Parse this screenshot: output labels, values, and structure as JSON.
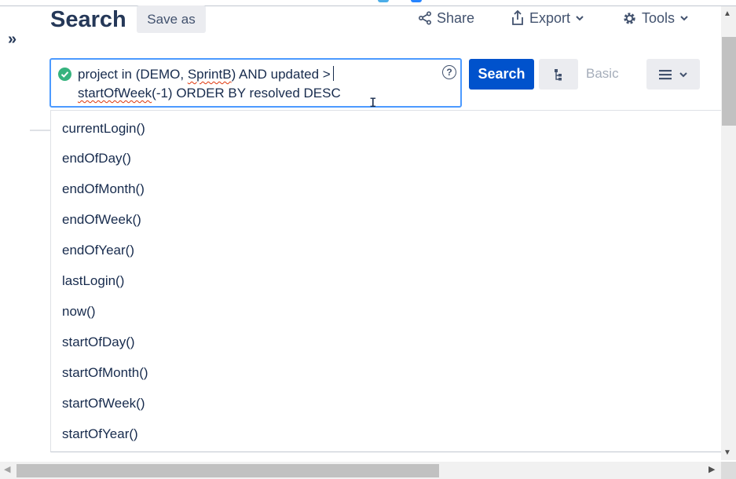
{
  "header": {
    "title": "Search",
    "save_as_label": "Save as",
    "share_label": "Share",
    "export_label": "Export",
    "tools_label": "Tools"
  },
  "query": {
    "line1_prefix": "project in (DEMO, ",
    "line1_squiggle": "SprintB",
    "line1_suffix": ") AND updated >",
    "line2_squiggle": "startOfWeek",
    "line2_suffix": "(-1) ORDER BY resolved DESC",
    "help_glyph": "?",
    "valid_status_color": "#36b37e"
  },
  "buttons": {
    "search_label": "Search",
    "basic_label": "Basic"
  },
  "suggestions": [
    "currentLogin()",
    "endOfDay()",
    "endOfMonth()",
    "endOfWeek()",
    "endOfYear()",
    "lastLogin()",
    "now()",
    "startOfDay()",
    "startOfMonth()",
    "startOfWeek()",
    "startOfYear()"
  ],
  "icons": {
    "expand": "double-chevron-right-icon",
    "share": "share-icon",
    "export": "export-icon",
    "tools": "gear-icon",
    "tree": "hierarchy-icon",
    "menu": "hamburger-icon",
    "help": "help-circle-icon",
    "valid": "check-circle-icon"
  },
  "colors": {
    "primary": "#0052cc",
    "focus_border": "#4c9aff",
    "text": "#172b4d",
    "muted_link": "#a5adba",
    "spell_error": "#de350b"
  }
}
